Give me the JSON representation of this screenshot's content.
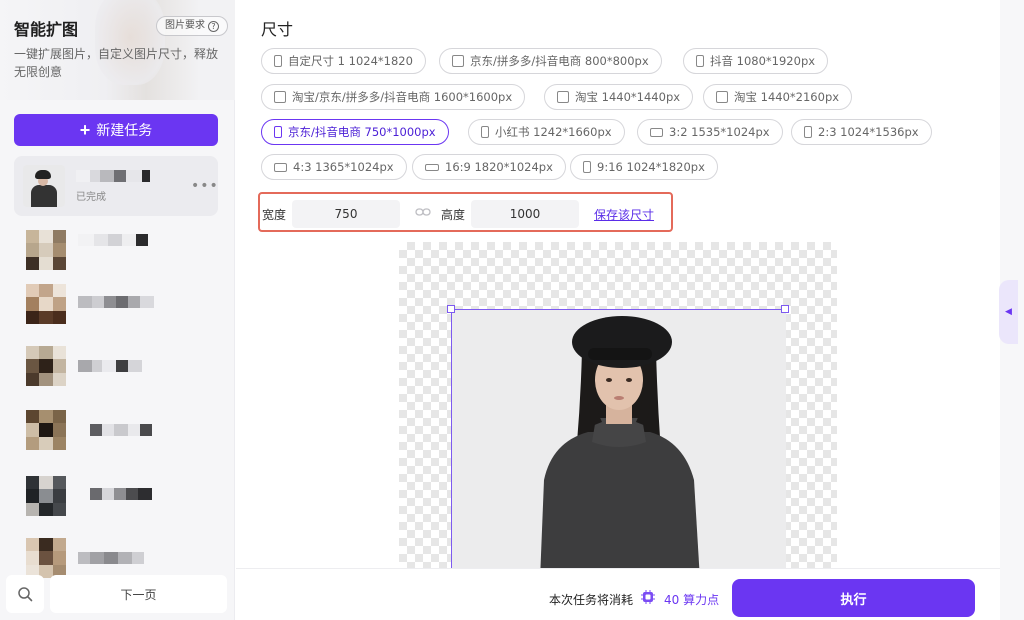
{
  "sidebar": {
    "title": "智能扩图",
    "requirements_label": "图片要求",
    "requirements_icon": "question-circle-icon",
    "description": "一键扩展图片，自定义图片尺寸，释放无限创意",
    "new_task_label": "新建任务",
    "active_task": {
      "status": "已完成",
      "more_icon": "more-dots-icon"
    },
    "next_page_label": "下一页",
    "search_icon": "search-icon"
  },
  "main": {
    "section_title": "尺寸",
    "presets": [
      {
        "label": "自定尺寸 1 1024*1820",
        "icon": "portrait"
      },
      {
        "label": "京东/拼多多/抖音电商 800*800px",
        "icon": "square"
      },
      {
        "label": "抖音 1080*1920px",
        "icon": "portrait"
      },
      {
        "label": "淘宝/京东/拼多多/抖音电商 1600*1600px",
        "icon": "square"
      },
      {
        "label": "淘宝 1440*1440px",
        "icon": "square"
      },
      {
        "label": "淘宝 1440*2160px",
        "icon": "square"
      },
      {
        "label": "京东/抖音电商 750*1000px",
        "icon": "portrait",
        "selected": true
      },
      {
        "label": "小红书 1242*1660px",
        "icon": "portrait"
      },
      {
        "label": "3:2 1535*1024px",
        "icon": "landscape"
      },
      {
        "label": "2:3 1024*1536px",
        "icon": "portrait"
      },
      {
        "label": "4:3 1365*1024px",
        "icon": "landscape"
      },
      {
        "label": "16:9 1820*1024px",
        "icon": "wide"
      },
      {
        "label": "9:16 1024*1820px",
        "icon": "portrait"
      }
    ],
    "width_label": "宽度",
    "width_value": "750",
    "height_label": "高度",
    "height_value": "1000",
    "save_size_label": "保存该尺寸"
  },
  "footer": {
    "cost_text": "本次任务将消耗",
    "cost_value": "40 算力点",
    "execute_label": "执行"
  },
  "colors": {
    "accent": "#6b36f2",
    "highlight_border": "#e46a5a"
  }
}
